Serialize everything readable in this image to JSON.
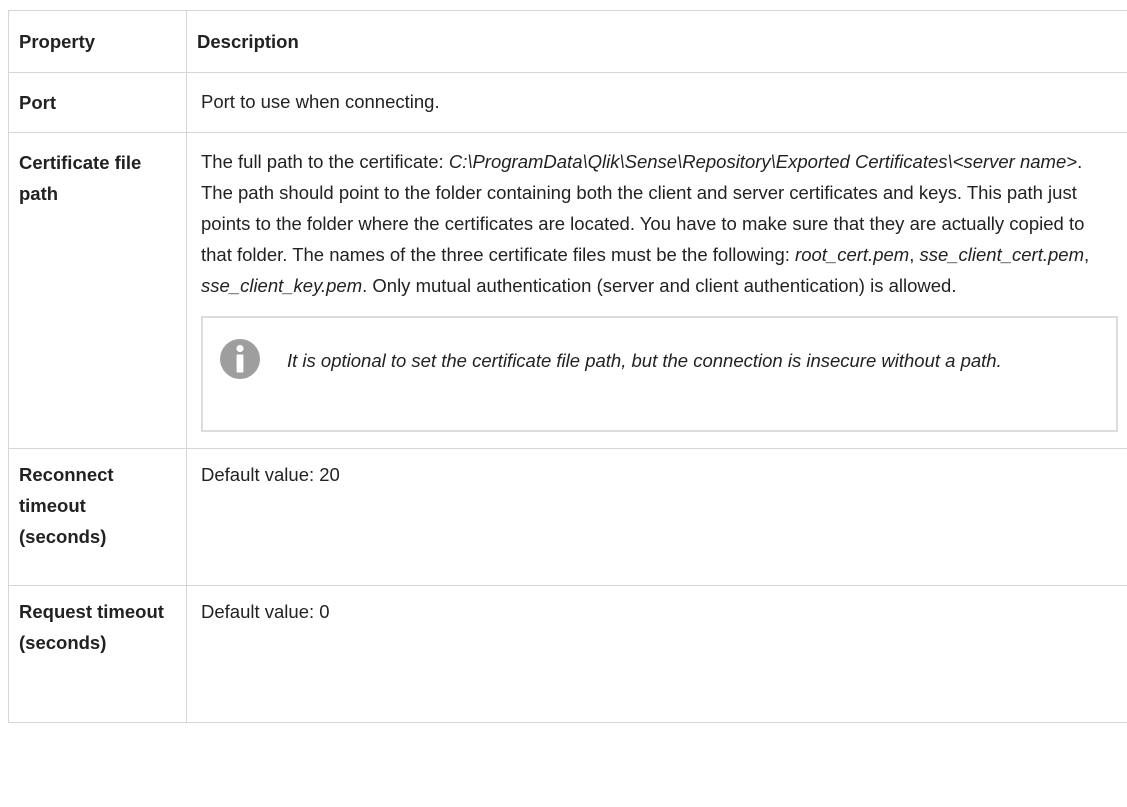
{
  "table": {
    "headers": {
      "property": "Property",
      "description": "Description"
    },
    "rows": {
      "port": {
        "property": "Port",
        "description": "Port to use when connecting."
      },
      "certificate": {
        "property": "Certificate file path",
        "desc_part1": "The full path to the certificate: ",
        "path_example": "C:\\ProgramData\\Qlik\\Sense\\Repository\\Exported Certificates\\<server name>",
        "desc_part2": ". The path should point to the folder containing both the client and server certificates and keys. This path just points to the folder where the certificates are located. You have to make sure that they are actually copied to that folder. The names of the three certificate files must be the following: ",
        "file_root": "root_cert.pem",
        "sep1": ", ",
        "file_client": "sse_client_cert.pem",
        "sep2": ", ",
        "file_key": "sse_client_key.pem",
        "desc_part3": ". Only mutual authentication (server and client authentication) is allowed.",
        "note": {
          "icon": "info-icon",
          "text": "It is optional to set the certificate file path, but the connection is insecure without a path."
        }
      },
      "reconnect": {
        "property": "Reconnect timeout (seconds)",
        "description": "Default value: 20"
      },
      "request": {
        "property": "Request timeout (seconds)",
        "description": "Default value: 0"
      }
    }
  },
  "colors": {
    "border": "#d6d6d6",
    "note_border": "#dcdcdc",
    "icon": "#9e9e9e",
    "text": "#222222"
  }
}
